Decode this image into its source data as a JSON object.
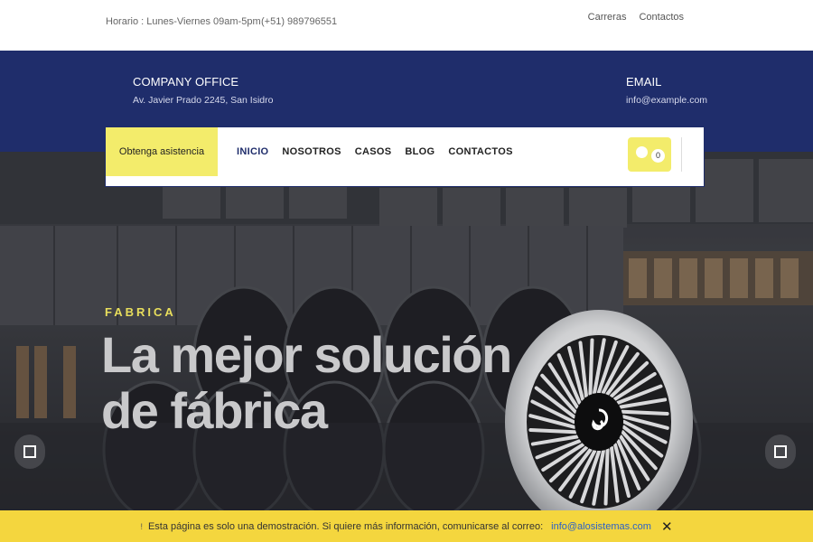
{
  "topbar": {
    "hours": "Horario : Lunes-Viernes 09am-5pm",
    "phone": "(+51) 989796551",
    "links": [
      "Carreras",
      "Contactos"
    ]
  },
  "info": {
    "office_title": "COMPANY OFFICE",
    "office_address": "Av. Javier Prado 2245, San Isidro",
    "email_title": "EMAIL",
    "email_value": "info@example.com"
  },
  "nav": {
    "assist_label": "Obtenga asistencia",
    "items": [
      "INICIO",
      "NOSOTROS",
      "CASOS",
      "BLOG",
      "CONTACTOS"
    ],
    "active_index": 0,
    "cart_count": "0"
  },
  "hero": {
    "kicker": "FABRICA",
    "headline_line1": "La mejor solución",
    "headline_line2": "de fábrica"
  },
  "demo": {
    "icon": "!",
    "message": "Esta página es solo una demostración. Si quiere más información, comunicarse al correo:",
    "email": "info@alosistemas.com",
    "close": "✕"
  },
  "colors": {
    "brand_blue": "#1f2d6b",
    "accent_yellow": "#f3ec6b",
    "banner_yellow": "#f4d63e",
    "kicker_yellow": "#e8de5c"
  }
}
